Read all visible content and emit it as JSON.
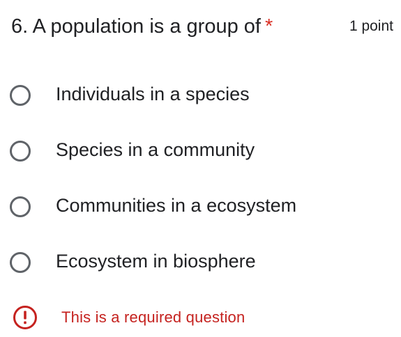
{
  "question": {
    "title": "6. A population is a group of",
    "required_marker": "*",
    "points_label": "1 point",
    "options": [
      {
        "label": "Individuals in a species",
        "selected": false
      },
      {
        "label": "Species in a community",
        "selected": false
      },
      {
        "label": "Communities in a ecosystem",
        "selected": false
      },
      {
        "label": "Ecosystem in biosphere",
        "selected": false
      }
    ],
    "error": {
      "icon": "exclamation-circle-icon",
      "message": "This is a required question"
    }
  },
  "colors": {
    "text": "#202124",
    "radio_border": "#5f6368",
    "required": "#d93025",
    "error": "#c5221f"
  }
}
